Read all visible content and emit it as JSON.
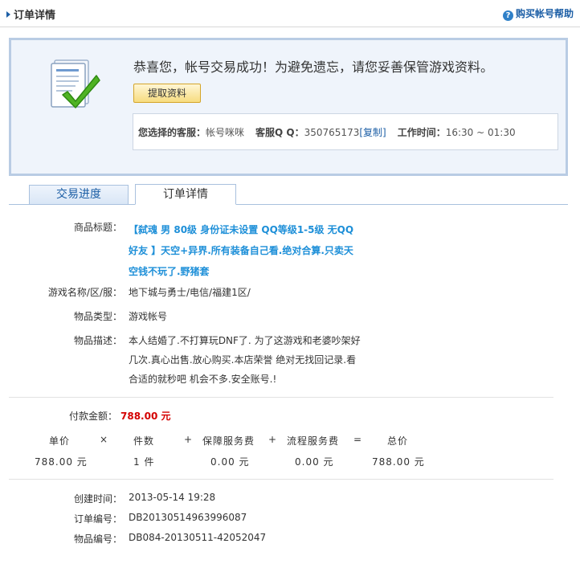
{
  "header": {
    "title": "订单详情",
    "help_link": "购买帐号帮助"
  },
  "success": {
    "message": "恭喜您，帐号交易成功！为避免遗忘，请您妥善保管游戏资料。",
    "fetch_button": "提取资料",
    "service": {
      "agent_label": "您选择的客服：",
      "agent_value": "帐号咪咪",
      "qq_label": "客服Q Q：",
      "qq_value": "350765173",
      "copy_label": "[复制]",
      "hours_label": "工作时间：",
      "hours_value": "16:30 ~ 01:30"
    }
  },
  "tabs": [
    {
      "label": "交易进度"
    },
    {
      "label": "订单详情"
    }
  ],
  "details": {
    "title_label": "商品标题：",
    "title_value": "【弑魂 男 80级 身份证未设置 QQ等级1-5级 无QQ好友 】天空+异界.所有装备自己看.绝对合算.只卖天空钱不玩了.野猪套",
    "server_label": "游戏名称/区/服：",
    "server_value": "地下城与勇士/电信/福建1区/",
    "type_label": "物品类型：",
    "type_value": "游戏帐号",
    "desc_label": "物品描述：",
    "desc_value": "本人结婚了.不打算玩DNF了. 为了这游戏和老婆吵架好几次.真心出售.放心购买.本店荣誉 绝对无找回记录.看合适的就秒吧 机会不多.安全账号.!"
  },
  "payment": {
    "amount_label": "付款金额：",
    "amount_value": "788.00 元",
    "headers": [
      "单价",
      "×",
      "件数",
      "+",
      "保障服务费",
      "+",
      "流程服务费",
      "=",
      "总价"
    ],
    "values": [
      "788.00 元",
      "1 件",
      "0.00 元",
      "0.00 元",
      "788.00 元"
    ]
  },
  "order": {
    "created_label": "创建时间：",
    "created_value": "2013-05-14 19:28",
    "order_no_label": "订单编号：",
    "order_no_value": "DB20130514963996087",
    "item_no_label": "物品编号：",
    "item_no_value": "DB084-20130511-42052047"
  }
}
